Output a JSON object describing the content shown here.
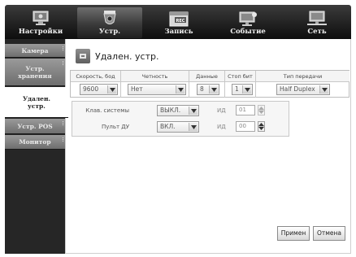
{
  "tabs": [
    {
      "label": "Настройки",
      "icon": "monitor-settings-icon"
    },
    {
      "label": "Устр.",
      "icon": "camera-icon"
    },
    {
      "label": "Запись",
      "icon": "rec-calendar-icon"
    },
    {
      "label": "Событие",
      "icon": "event-monitor-icon"
    },
    {
      "label": "Сеть",
      "icon": "network-icon"
    }
  ],
  "sidebar": {
    "items": [
      {
        "label": "Камера"
      },
      {
        "label": "Устр.\nхранения"
      },
      {
        "label": "Удален.\nустр."
      },
      {
        "label": "Устр. POS"
      },
      {
        "label": "Монитор"
      }
    ]
  },
  "page": {
    "title": "Удален. устр.",
    "icon": "remote-device-icon"
  },
  "serial": {
    "headers": [
      "Скорость, бод",
      "Четность",
      "Данные",
      "Стоп бит",
      "Тип передачи"
    ],
    "values": [
      "9600",
      "Нет",
      "8",
      "1",
      "Half Duplex"
    ]
  },
  "controls": {
    "system_keyboard": {
      "label": "Клав. системы",
      "value": "ВЫКЛ.",
      "id_label": "ИД",
      "id_value": "01"
    },
    "remote": {
      "label": "Пульт ДУ",
      "value": "ВКЛ.",
      "id_label": "ИД",
      "id_value": "00"
    }
  },
  "buttons": {
    "apply": "Примен",
    "cancel": "Отмена"
  }
}
